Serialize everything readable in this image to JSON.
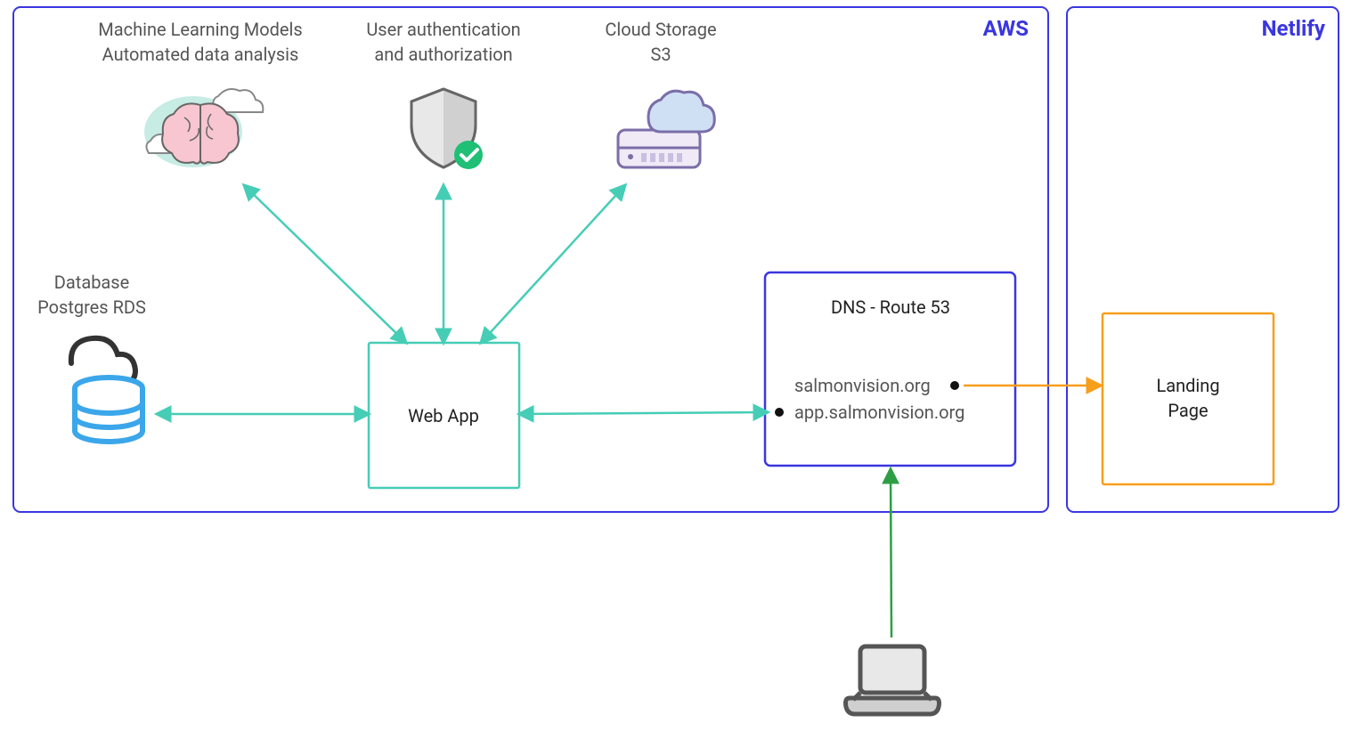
{
  "containers": {
    "aws": {
      "label": "AWS"
    },
    "netlify": {
      "label": "Netlify"
    }
  },
  "nodes": {
    "ml": {
      "line1": "Machine Learning Models",
      "line2": "Automated data analysis"
    },
    "auth": {
      "line1": "User authentication",
      "line2": "and authorization"
    },
    "storage": {
      "line1": "Cloud Storage",
      "line2": "S3"
    },
    "db": {
      "line1": "Database",
      "line2": "Postgres RDS"
    },
    "webapp": {
      "label": "Web App"
    },
    "dns": {
      "title": "DNS - Route 53",
      "entry1": "salmonvision.org",
      "entry2": "app.salmonvision.org"
    },
    "landing": {
      "line1": "Landing",
      "line2": "Page"
    }
  },
  "colors": {
    "container_border": "#3a36e0",
    "teal": "#46cdb6",
    "orange": "#f79e1b",
    "green": "#2e9e44",
    "dns_border": "#3a36e0"
  }
}
